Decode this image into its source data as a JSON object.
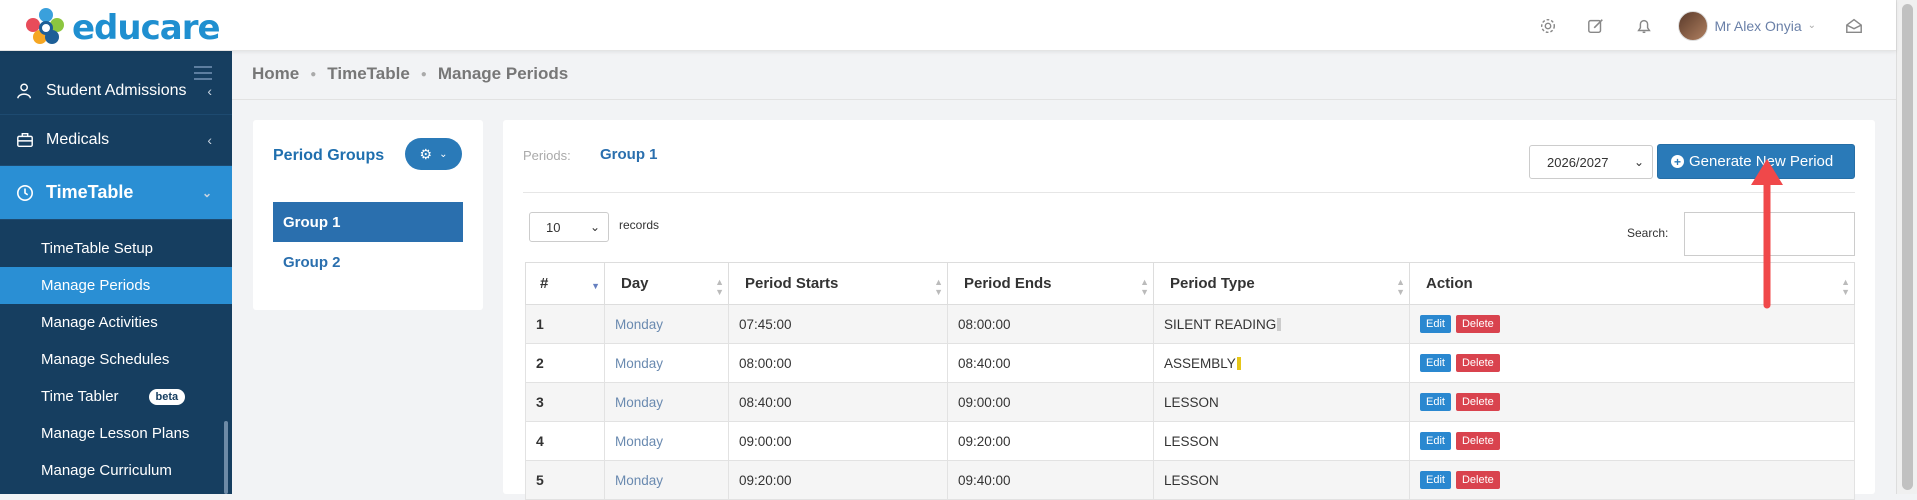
{
  "brand": {
    "name": "educare"
  },
  "topbar": {
    "icons": [
      "gear-icon",
      "edit-icon",
      "bell-icon",
      "inbox-icon"
    ],
    "user_name": "Mr Alex Onyia"
  },
  "sidebar": {
    "items": [
      {
        "label": "Student Admissions",
        "icon": "student-icon"
      },
      {
        "label": "Medicals",
        "icon": "briefcase-icon"
      },
      {
        "label": "TimeTable",
        "icon": "clock-icon"
      }
    ],
    "sub_items": [
      {
        "label": "TimeTable Setup"
      },
      {
        "label": "Manage Periods"
      },
      {
        "label": "Manage Activities"
      },
      {
        "label": "Manage Schedules"
      },
      {
        "label": "Time Tabler",
        "badge": "beta"
      },
      {
        "label": "Manage Lesson Plans"
      },
      {
        "label": "Manage Curriculum"
      }
    ]
  },
  "breadcrumb": [
    "Home",
    "TimeTable",
    "Manage Periods"
  ],
  "period_groups": {
    "title": "Period Groups",
    "groups": [
      "Group 1",
      "Group 2"
    ]
  },
  "main": {
    "periods_label": "Periods:",
    "group_name": "Group 1",
    "year": "2026/2027",
    "generate_label": "Generate New Period",
    "page_length": "10",
    "records_label": "records",
    "search_label": "Search:",
    "columns": [
      "#",
      "Day",
      "Period Starts",
      "Period Ends",
      "Period Type",
      "Action"
    ],
    "rows": [
      {
        "num": "1",
        "day": "Monday",
        "start": "07:45:00",
        "end": "08:00:00",
        "type": "SILENT READING"
      },
      {
        "num": "2",
        "day": "Monday",
        "start": "08:00:00",
        "end": "08:40:00",
        "type": "ASSEMBLY"
      },
      {
        "num": "3",
        "day": "Monday",
        "start": "08:40:00",
        "end": "09:00:00",
        "type": "LESSON"
      },
      {
        "num": "4",
        "day": "Monday",
        "start": "09:00:00",
        "end": "09:20:00",
        "type": "LESSON"
      },
      {
        "num": "5",
        "day": "Monday",
        "start": "09:20:00",
        "end": "09:40:00",
        "type": "LESSON"
      }
    ],
    "edit_label": "Edit",
    "delete_label": "Delete",
    "type_marker_colors": [
      "#cccccc",
      "#e6c619",
      "",
      "",
      ""
    ]
  },
  "colors": {
    "sidebar_bg": "#163e60",
    "accent": "#2a8fd4",
    "primary_button": "#2a7ab8",
    "delete_button": "#d9434e",
    "arrow": "#f0484a"
  }
}
